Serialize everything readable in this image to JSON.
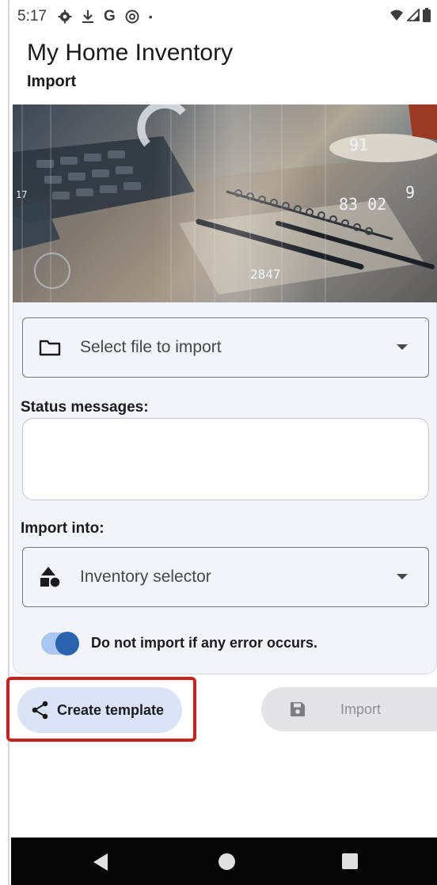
{
  "status_bar": {
    "time": "5:17",
    "left_icons": [
      "gear-icon",
      "download-icon",
      "google-icon",
      "at-icon",
      "dot-icon"
    ],
    "right_icons": [
      "wifi-icon",
      "signal-icon",
      "battery-icon"
    ]
  },
  "header": {
    "title": "My Home Inventory",
    "subtitle": "Import"
  },
  "hero_image": {
    "numbers": [
      "91",
      "83 02",
      "9",
      "17",
      "2847"
    ]
  },
  "file_select": {
    "label": "Select file to import",
    "icon": "folder-icon"
  },
  "status_messages": {
    "label": "Status messages:",
    "value": ""
  },
  "import_into": {
    "label": "Import into:",
    "selector_label": "Inventory selector",
    "icon": "shapes-icon"
  },
  "error_toggle": {
    "label": "Do not import if any error occurs.",
    "on": true
  },
  "actions": {
    "create_template_label": "Create template",
    "import_label": "Import",
    "import_enabled": false
  },
  "colors": {
    "accent": "#2a63ad",
    "highlight": "#c9211e",
    "tonal_button": "#dbe4f6"
  }
}
